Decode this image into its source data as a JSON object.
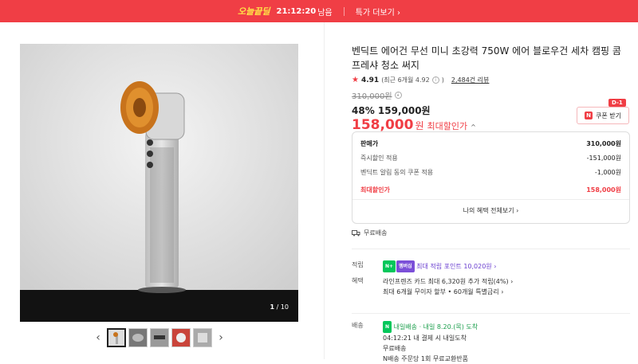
{
  "banner": {
    "logo": "오늘끝딜",
    "timer": "21:12:20",
    "remaining": "남음",
    "link": "특가 더보기 ›"
  },
  "gallery": {
    "current": "1",
    "total": "/ 10",
    "prev": "‹",
    "next": "›"
  },
  "product": {
    "title": "벤딕트 에어건 무선 미니 초강력 750W 에어 블로우건 세차 캠핑 콤프레샤 청소 써지",
    "rating": "4.91",
    "recent_rating": "(최근 6개월 4.92",
    "info_mark": "i",
    "close_paren": ")",
    "reviews": "2,484건 리뷰",
    "original_price": "310,000원",
    "discount_price": "48% 159,000원",
    "max_price_num": "158,000",
    "max_price_unit": "원",
    "max_price_label": "최대할인가",
    "chevron": "^"
  },
  "coupon": {
    "badge": "D-1",
    "icon_letter": "N",
    "label": "쿠폰 받기"
  },
  "pricebox": {
    "rows": [
      {
        "label": "판매가",
        "value": "310,000원"
      },
      {
        "label": "즉시할인 적용",
        "value": "-151,000원"
      },
      {
        "label": "벤딕트 알림 동의 쿠폰 적용",
        "value": "-1,000원"
      }
    ],
    "total_label": "최대할인가",
    "total_value": "158,000원",
    "all_benefits": "나의 혜택 전체보기 ›"
  },
  "shipping_free": "무료배송",
  "points": {
    "label": "적립",
    "tag1": "N+",
    "tag2": "멤버십",
    "text": "최대 적립 포인트 10,020원 ›"
  },
  "benefits": {
    "label": "혜택",
    "line1": "라인프렌즈 카드 최대 6,320원 추가 적립(4%) ›",
    "line2": "최대 6개월 무이자 할부 • 60개월 특별금리 ›"
  },
  "delivery": {
    "label": "배송",
    "tag": "N",
    "line1_a": "내일배송",
    "line1_b": "· 내일 8.20.(목) 도착",
    "line2": "04:12:21  내 결제 시 내일도착",
    "line3": "무료배송",
    "line4": "N배송 주문당 1회 무료교환반품"
  },
  "colors": {
    "accent": "#f03e45",
    "naver_green": "#03c75a",
    "membership_purple": "#7b4fd8"
  }
}
